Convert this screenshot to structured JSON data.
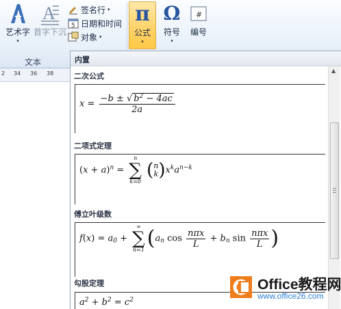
{
  "ribbon": {
    "wordart_label": "艺术字",
    "dropcap_label": "首字下沉",
    "signature_label": "签名行",
    "datetime_label": "日期和时间",
    "object_label": "对象",
    "equation_label": "公式",
    "symbol_label": "符号",
    "number_label": "编号",
    "group_text_label": "文本",
    "number_icon_glyph": "#",
    "symbol_icon_glyph": "Ω",
    "equation_icon_glyph": "π",
    "datetime_icon_glyph": "5",
    "accent_color": "#ffd36b"
  },
  "ruler": {
    "ticks": [
      "2",
      "34",
      "36",
      "38"
    ]
  },
  "gallery": {
    "header": "内置",
    "equations": [
      {
        "title": "二次公式"
      },
      {
        "title": "二项式定理"
      },
      {
        "title": "傅立叶级数"
      },
      {
        "title": "勾股定理"
      }
    ]
  },
  "watermark": {
    "name": "Office教程网",
    "url": "www.office26.com"
  }
}
